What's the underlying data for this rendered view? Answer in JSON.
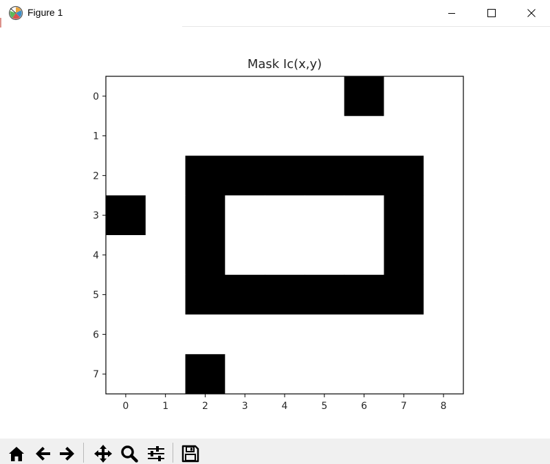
{
  "window": {
    "title": "Figure 1",
    "minimize_glyph": "—",
    "maximize_glyph": "☐",
    "close_glyph": "✕"
  },
  "toolbar": {
    "buttons": [
      {
        "name": "home-button",
        "icon": "home-icon",
        "tooltip": "Reset original view"
      },
      {
        "name": "back-button",
        "icon": "arrow-left-icon",
        "tooltip": "Back"
      },
      {
        "name": "forward-button",
        "icon": "arrow-right-icon",
        "tooltip": "Forward"
      },
      {
        "name": "pan-button",
        "icon": "move-arrows-icon",
        "tooltip": "Pan"
      },
      {
        "name": "zoom-button",
        "icon": "magnifier-icon",
        "tooltip": "Zoom"
      },
      {
        "name": "configure-button",
        "icon": "sliders-icon",
        "tooltip": "Configure subplots"
      },
      {
        "name": "save-button",
        "icon": "floppy-disk-icon",
        "tooltip": "Save the figure"
      }
    ]
  },
  "chart_data": {
    "type": "heatmap",
    "title": "Mask Ic(x,y)",
    "xlabel": "",
    "ylabel": "",
    "colormap": "gray",
    "color_zero": "#000000",
    "color_one": "#ffffff",
    "x_ticks": [
      0,
      1,
      2,
      3,
      4,
      5,
      6,
      7,
      8
    ],
    "y_ticks": [
      0,
      1,
      2,
      3,
      4,
      5,
      6,
      7
    ],
    "xlim": [
      -0.5,
      8.5
    ],
    "ylim": [
      7.5,
      -0.5
    ],
    "grid": false,
    "matrix": [
      [
        1,
        1,
        1,
        1,
        1,
        1,
        0,
        1,
        1
      ],
      [
        1,
        1,
        1,
        1,
        1,
        1,
        1,
        1,
        1
      ],
      [
        1,
        1,
        0,
        0,
        0,
        0,
        0,
        0,
        1
      ],
      [
        0,
        1,
        0,
        1,
        1,
        1,
        1,
        0,
        1
      ],
      [
        1,
        1,
        0,
        1,
        1,
        1,
        1,
        0,
        1
      ],
      [
        1,
        1,
        0,
        0,
        0,
        0,
        0,
        0,
        1
      ],
      [
        1,
        1,
        1,
        1,
        1,
        1,
        1,
        1,
        1
      ],
      [
        1,
        1,
        0,
        1,
        1,
        1,
        1,
        1,
        1
      ]
    ]
  }
}
